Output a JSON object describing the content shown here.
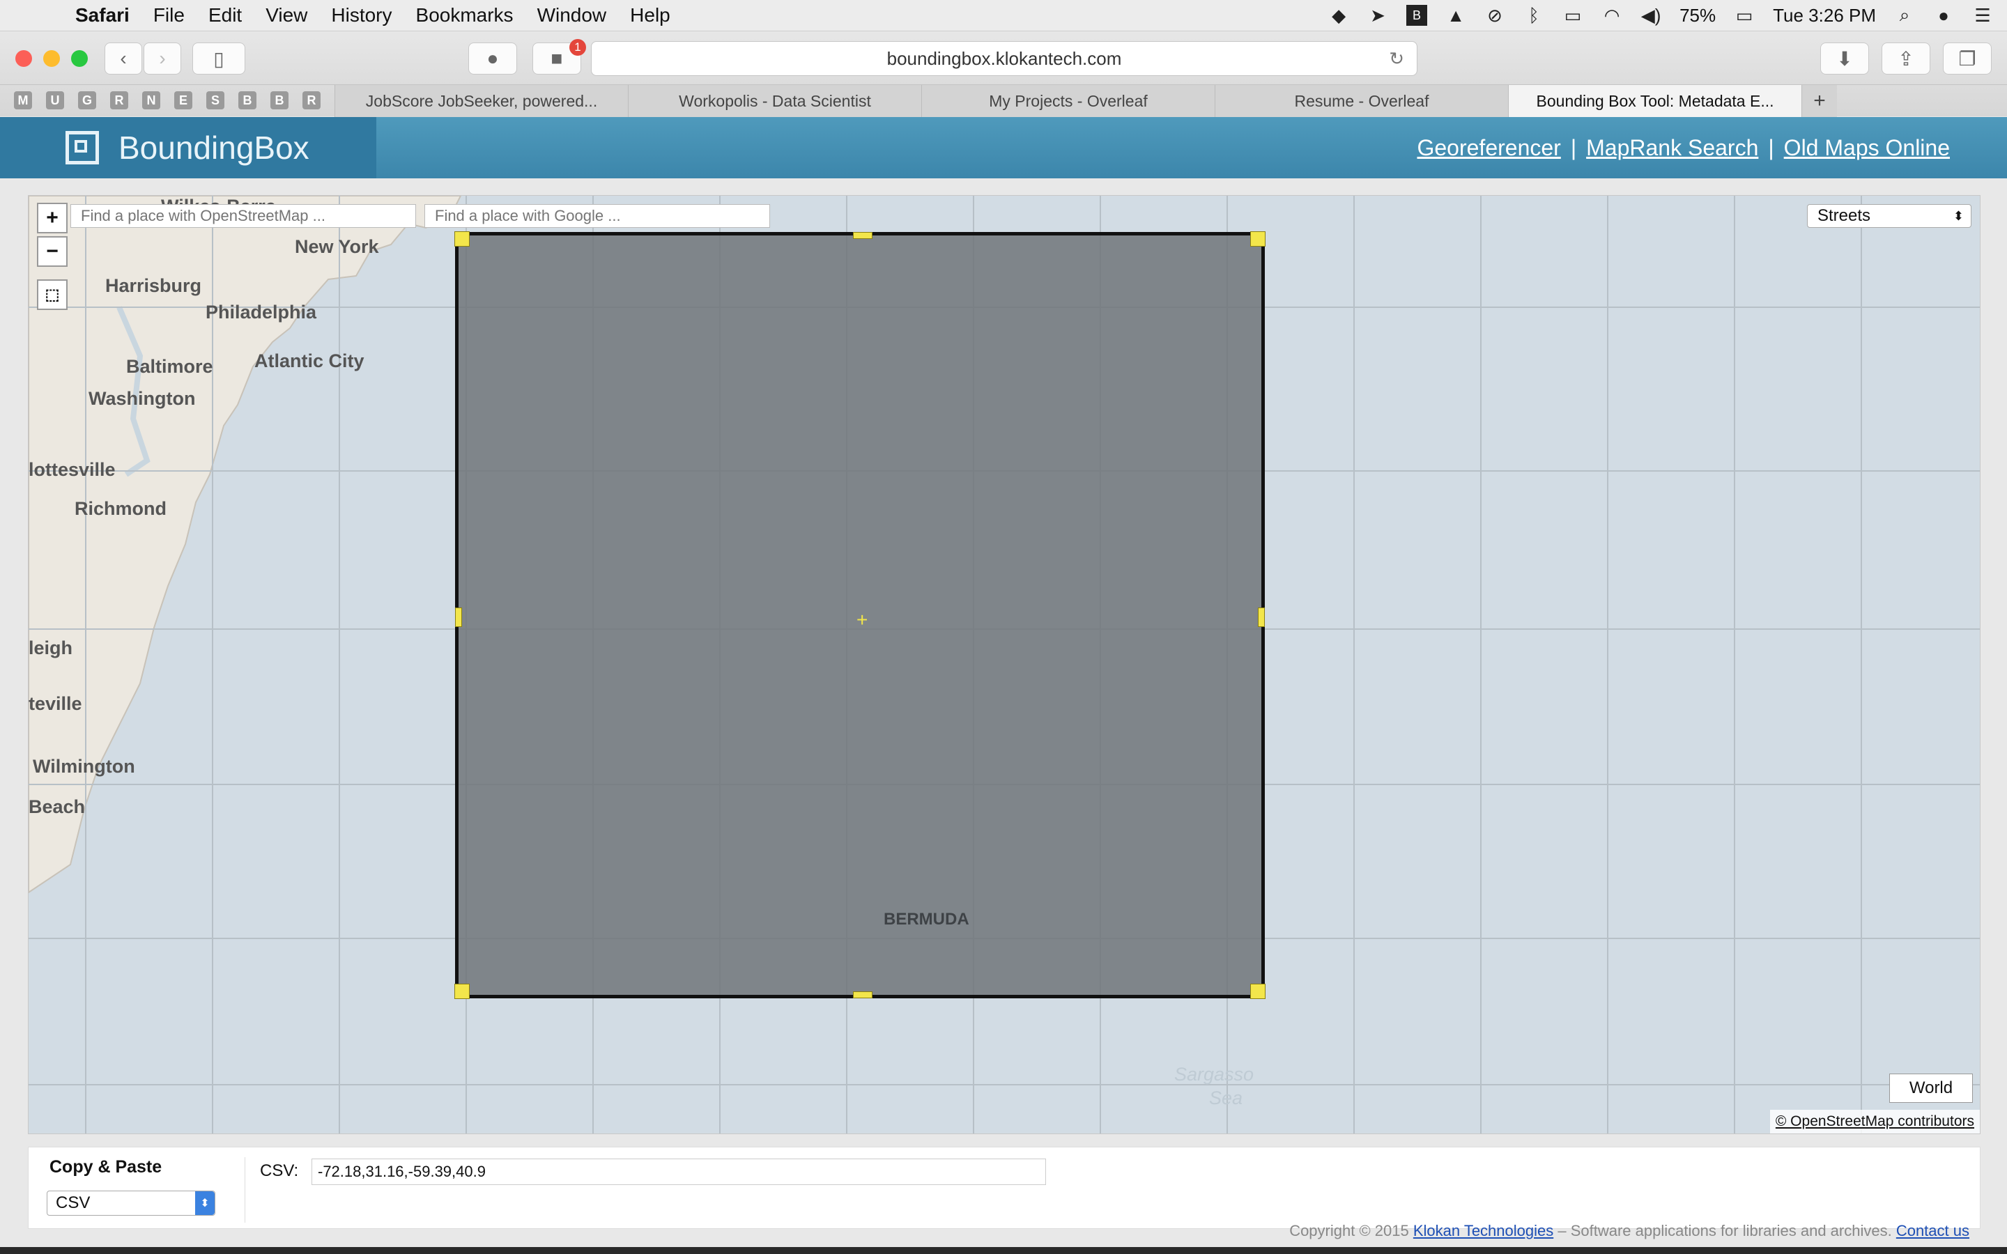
{
  "menubar": {
    "app": "Safari",
    "items": [
      "File",
      "Edit",
      "View",
      "History",
      "Bookmarks",
      "Window",
      "Help"
    ],
    "battery": "75%",
    "clock": "Tue 3:26 PM"
  },
  "toolbar": {
    "address": "boundingbox.klokantech.com",
    "notification_count": "1"
  },
  "tabs": {
    "pinned": [
      "M",
      "U",
      "G",
      "R",
      "N",
      "E",
      "S",
      "B",
      "B",
      "R"
    ],
    "open": [
      "JobScore JobSeeker, powered...",
      "Workopolis - Data Scientist",
      "My Projects - Overleaf",
      "Resume - Overleaf",
      "Bounding Box Tool: Metadata E..."
    ],
    "active_index": 4,
    "new_tab": "+"
  },
  "header": {
    "logo_text": "BoundingBox",
    "links": [
      "Georeferencer",
      "MapRank Search",
      "Old Maps Online"
    ],
    "separator": "|"
  },
  "map": {
    "zoom_in": "+",
    "zoom_out": "−",
    "osm_search_placeholder": "Find a place with OpenStreetMap ...",
    "google_search_placeholder": "Find a place with Google ...",
    "layer_select": "Streets",
    "places": {
      "wilkes_barre": "Wilkes-Barre",
      "new_york": "New York",
      "harrisburg": "Harrisburg",
      "philadelphia": "Philadelphia",
      "atlantic_city": "Atlantic City",
      "baltimore": "Baltimore",
      "washington": "Washington",
      "charlottesville": "lottesville",
      "richmond": "Richmond",
      "raleigh": "leigh",
      "fayetteville": "teville",
      "wilmington": "Wilmington",
      "beach": "Beach",
      "bermuda": "BERMUDA",
      "sargasso": "Sargasso",
      "sea": "Sea"
    },
    "world_button": "World",
    "attribution": "© OpenStreetMap contributors"
  },
  "copy_paste": {
    "title": "Copy & Paste",
    "format": "CSV",
    "csv_label": "CSV:",
    "csv_value": "-72.18,31.16,-59.39,40.9"
  },
  "footer": {
    "copyright": "Copyright © 2015 ",
    "company": "Klokan Technologies",
    "tagline": " – Software applications for libraries and archives. ",
    "contact": "Contact us"
  },
  "colors": {
    "header_bar": "#3c86ab",
    "logo_bg": "#3079a0",
    "map_water": "#d2dce4",
    "map_land": "#ece8e0",
    "bbox_fill": "#6c7176",
    "handle": "#f3e64b"
  }
}
